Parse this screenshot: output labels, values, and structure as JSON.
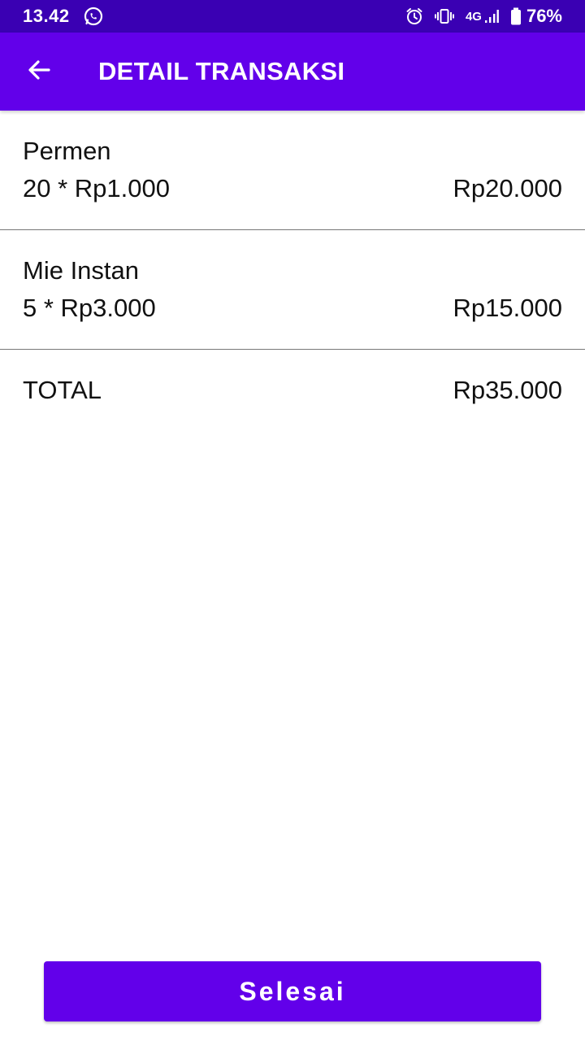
{
  "status_bar": {
    "time": "13.42",
    "network": "4G",
    "battery": "76%",
    "icons": [
      "whatsapp-icon",
      "alarm-icon",
      "vibrate-icon",
      "signal-icon",
      "battery-icon"
    ]
  },
  "app_bar": {
    "title": "DETAIL TRANSAKSI",
    "back_icon": "arrow-back-icon"
  },
  "items": [
    {
      "name": "Permen",
      "qty_price": "20 * Rp1.000",
      "subtotal": "Rp20.000"
    },
    {
      "name": "Mie Instan",
      "qty_price": "5 * Rp3.000",
      "subtotal": "Rp15.000"
    }
  ],
  "total": {
    "label": "TOTAL",
    "value": "Rp35.000"
  },
  "finish_button": {
    "label": "Selesai"
  },
  "colors": {
    "status_bar": "#3a00b3",
    "primary": "#6200ea",
    "divider": "#777777"
  }
}
